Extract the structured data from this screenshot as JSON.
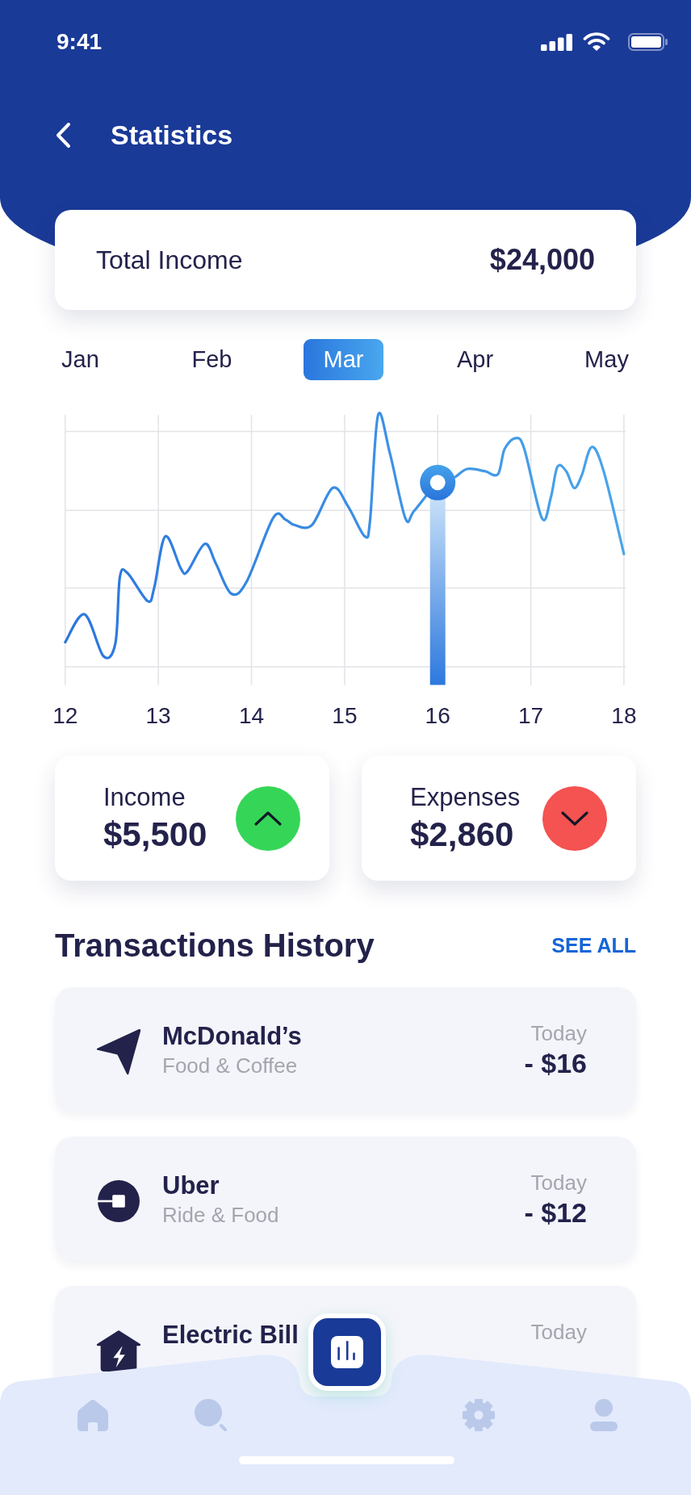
{
  "status_bar": {
    "time": "9:41"
  },
  "header": {
    "title": "Statistics"
  },
  "total_income": {
    "label": "Total Income",
    "amount": "$24,000"
  },
  "months": [
    {
      "label": "Jan",
      "selected": false
    },
    {
      "label": "Feb",
      "selected": false
    },
    {
      "label": "Mar",
      "selected": true
    },
    {
      "label": "Apr",
      "selected": false
    },
    {
      "label": "May",
      "selected": false
    }
  ],
  "chart": {
    "x_labels": [
      {
        "label": "12",
        "selected": false
      },
      {
        "label": "13",
        "selected": false
      },
      {
        "label": "14",
        "selected": false
      },
      {
        "label": "15",
        "selected": false
      },
      {
        "label": "16",
        "selected": true
      },
      {
        "label": "17",
        "selected": false
      },
      {
        "label": "18",
        "selected": false
      }
    ]
  },
  "summary_cards": [
    {
      "kind": "income",
      "label": "Income",
      "amount": "$5,500",
      "color": "#35d657"
    },
    {
      "kind": "expenses",
      "label": "Expenses",
      "amount": "$2,860",
      "color": "#f55252"
    }
  ],
  "transactions": {
    "title": "Transactions History",
    "see_all": "SEE ALL",
    "items": [
      {
        "kind": "send",
        "name": "McDonald’s",
        "category": "Food & Coffee",
        "date": "Today",
        "amount": "- $16"
      },
      {
        "kind": "ride",
        "name": "Uber",
        "category": "Ride & Food",
        "date": "Today",
        "amount": "- $12"
      },
      {
        "kind": "bill",
        "name": "Electric Bill",
        "date": "Today"
      }
    ]
  },
  "bottom_nav": {
    "items": [
      {
        "kind": "home",
        "selected": false
      },
      {
        "kind": "search",
        "selected": false
      },
      {
        "kind": "stats",
        "selected": true
      },
      {
        "kind": "settings",
        "selected": false
      },
      {
        "kind": "profile",
        "selected": false
      }
    ]
  }
}
